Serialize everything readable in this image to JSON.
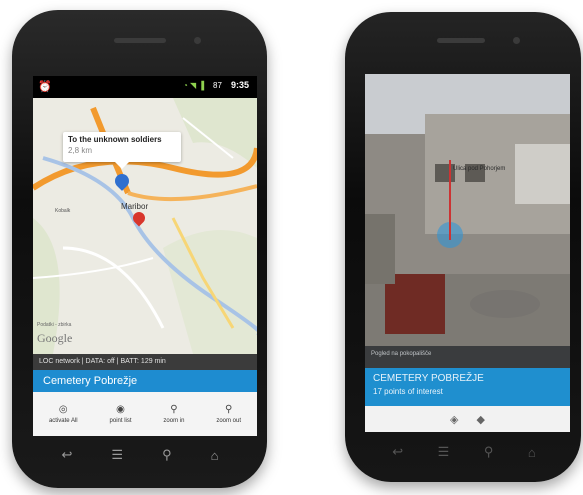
{
  "phone1": {
    "status": {
      "time": "9:35",
      "battery": "87"
    },
    "callout": {
      "title": "To the unknown soldiers",
      "distance": "2,8 km"
    },
    "map": {
      "city_label": "Maribor",
      "map_label": "Kobalk",
      "map_credit": "Podatki - zbirka",
      "google": "Google"
    },
    "infobar": "LOC network | DATA: off | BATT: 129 min",
    "title": "Cemetery Pobrežje",
    "actions": [
      {
        "label": "activate All",
        "icon": "globe-icon"
      },
      {
        "label": "point list",
        "icon": "list-icon"
      },
      {
        "label": "zoom in",
        "icon": "zoom-in-icon"
      },
      {
        "label": "zoom out",
        "icon": "zoom-out-icon"
      }
    ]
  },
  "phone2": {
    "ar_label": "Ulica pod Pohorjem",
    "ar_strip": "Pogled na pokopališče",
    "title": "CEMETERY POBREŽJE",
    "subtitle": "17 points of interest"
  },
  "colors": {
    "accent": "#1e8cd0",
    "screen_bg": "#000000"
  }
}
